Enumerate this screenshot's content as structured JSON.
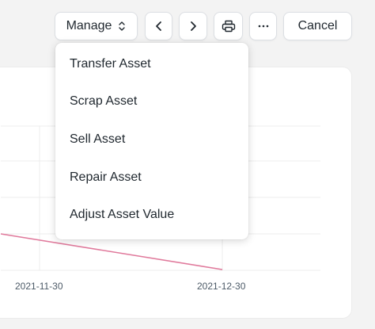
{
  "toolbar": {
    "manage_label": "Manage",
    "cancel_label": "Cancel"
  },
  "menu": {
    "items": [
      {
        "label": "Transfer Asset"
      },
      {
        "label": "Scrap Asset"
      },
      {
        "label": "Sell Asset"
      },
      {
        "label": "Repair Asset"
      },
      {
        "label": "Adjust Asset Value"
      }
    ]
  },
  "colors": {
    "line": "#e07a9c",
    "grid": "#ececec"
  },
  "chart_data": {
    "type": "line",
    "x": [
      "2021-11-30",
      "2021-12-30"
    ],
    "x_tick_labels": [
      "2021-11-30",
      "2021-12-30"
    ],
    "series": [
      {
        "values": [
          null,
          null
        ]
      }
    ]
  }
}
